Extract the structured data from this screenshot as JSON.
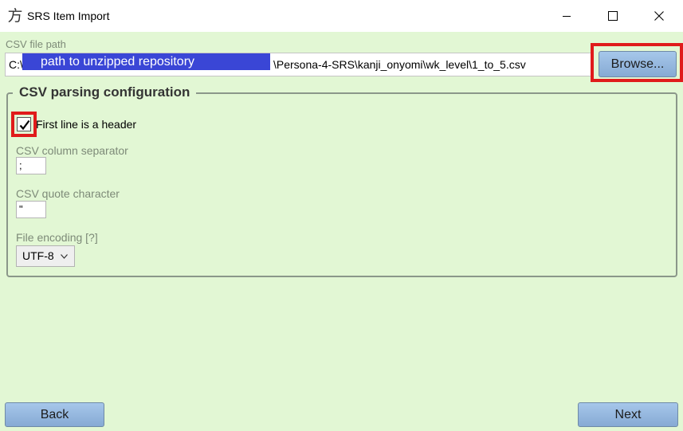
{
  "window": {
    "title": "SRS Item Import",
    "icon_glyph": "方",
    "icon": "app-kanji-icon"
  },
  "csv_path": {
    "label": "CSV file path",
    "prefix": "C:\\",
    "redacted_label": "path to unzipped repository",
    "suffix": "\\Persona-4-SRS\\kanji_onyomi\\wk_level\\1_to_5.csv",
    "browse_label": "Browse..."
  },
  "config": {
    "title": "CSV parsing configuration",
    "header_checkbox": {
      "label": "First line is a header",
      "checked": true
    },
    "separator": {
      "label": "CSV column separator",
      "value": ";"
    },
    "quote": {
      "label": "CSV quote character",
      "value": "\""
    },
    "encoding": {
      "label": "File encoding [?]",
      "value": "UTF-8"
    }
  },
  "nav": {
    "back_label": "Back",
    "next_label": "Next"
  },
  "colors": {
    "background": "#e2f7d4",
    "highlight": "#e01b1b",
    "redaction": "#3a46d6",
    "button": "#97b9df"
  }
}
